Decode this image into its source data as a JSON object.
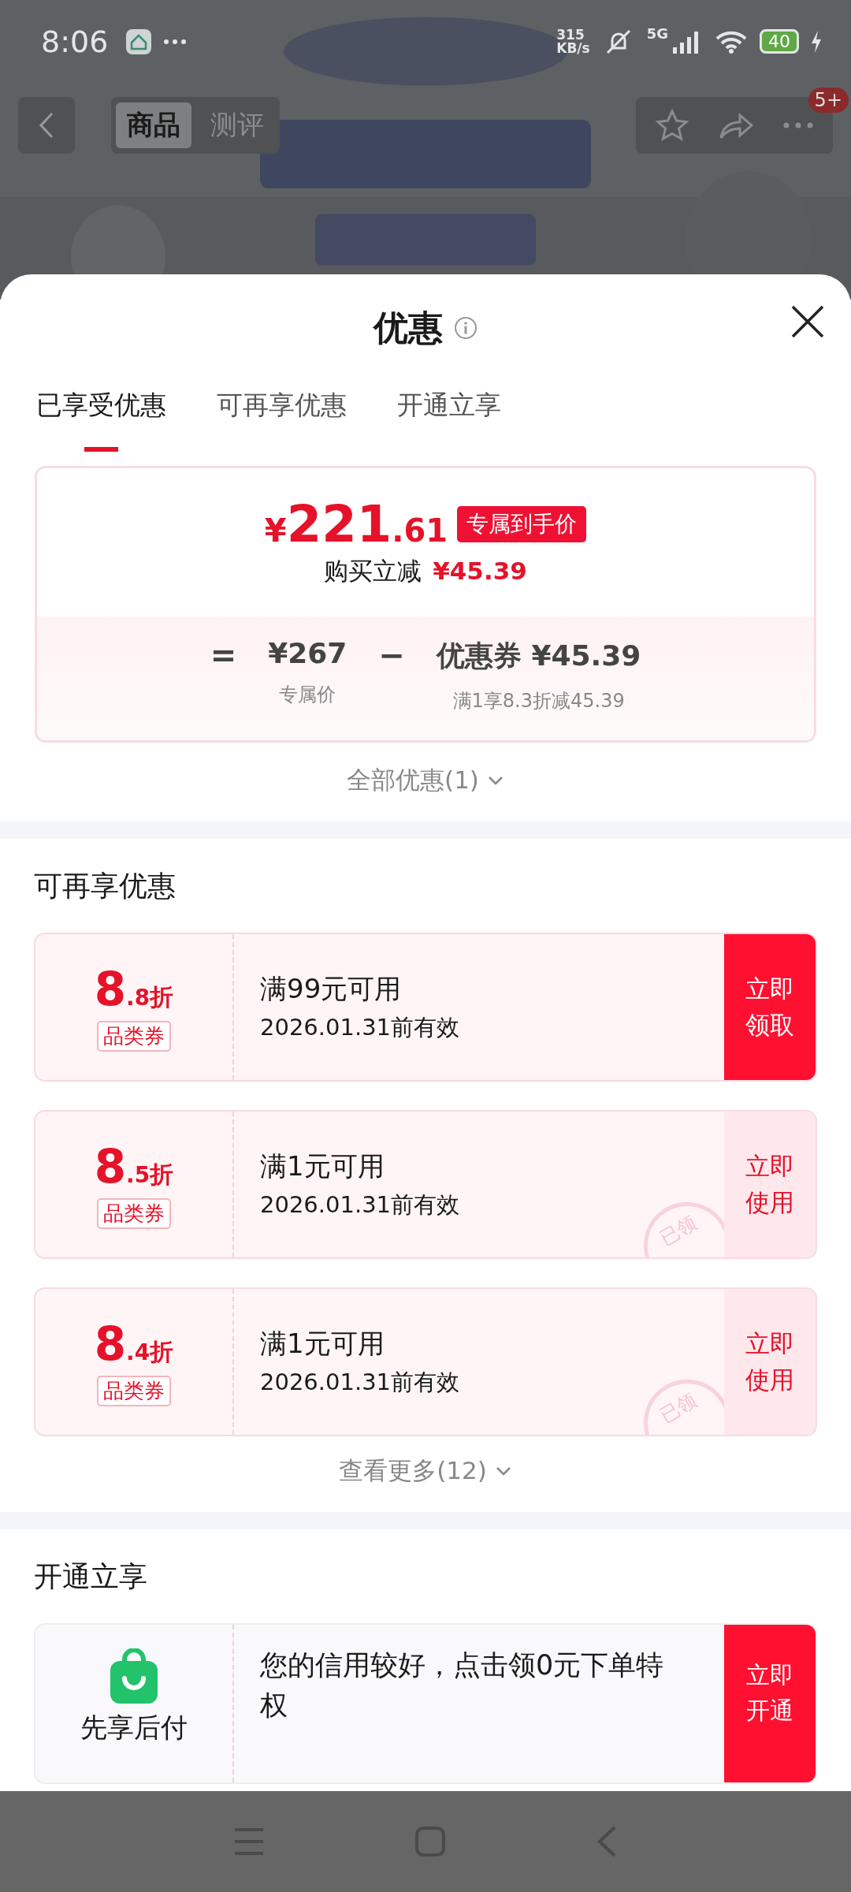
{
  "status_bar": {
    "time": "8:06",
    "net_speed": [
      "315",
      "KB/s"
    ],
    "network": "5G",
    "battery": "40"
  },
  "nav": {
    "tabs": [
      {
        "label": "商品",
        "selected": true
      },
      {
        "label": "测评",
        "selected": false
      }
    ],
    "badge": "5+"
  },
  "sheet": {
    "title": "优惠",
    "tabs": [
      {
        "label": "已享受优惠",
        "selected": true
      },
      {
        "label": "可再享优惠",
        "selected": false
      },
      {
        "label": "开通立享",
        "selected": false
      }
    ],
    "price_card": {
      "currency": "¥",
      "integer": "221",
      "decimal": ".61",
      "tag": "专属到手价",
      "saving_label": "购买立减",
      "saving": "¥45.39",
      "breakdown": [
        {
          "kind": "operator",
          "text": "="
        },
        {
          "kind": "term",
          "value": "¥267",
          "note": "专属价"
        },
        {
          "kind": "operator",
          "text": "−"
        },
        {
          "kind": "term",
          "value": "优惠券 ¥45.39",
          "note": "满1享8.3折减45.39"
        }
      ]
    },
    "all_link": "全部优惠(1)",
    "sections": [
      {
        "title": "可再享优惠",
        "kind": "coupons",
        "coupons": [
          {
            "main": "8",
            "decimal": ".8",
            "unit": "折",
            "type": "品类券",
            "condition": "满99元可用",
            "expiry": "2026.01.31前有效",
            "action": [
              "立即",
              "领取"
            ],
            "claimed": false
          },
          {
            "main": "8",
            "decimal": ".5",
            "unit": "折",
            "type": "品类券",
            "condition": "满1元可用",
            "expiry": "2026.01.31前有效",
            "action": [
              "立即",
              "使用"
            ],
            "claimed": true,
            "stamp": "已领"
          },
          {
            "main": "8",
            "decimal": ".4",
            "unit": "折",
            "type": "品类券",
            "condition": "满1元可用",
            "expiry": "2026.01.31前有效",
            "action": [
              "立即",
              "使用"
            ],
            "claimed": true,
            "stamp": "已领"
          }
        ],
        "more": "查看更多(12)"
      },
      {
        "title": "开通立享",
        "kind": "service",
        "service": {
          "name": "先享后付",
          "text": "您的信用较好，点击领0元下单特权",
          "action": [
            "立即",
            "开通"
          ]
        }
      }
    ]
  }
}
